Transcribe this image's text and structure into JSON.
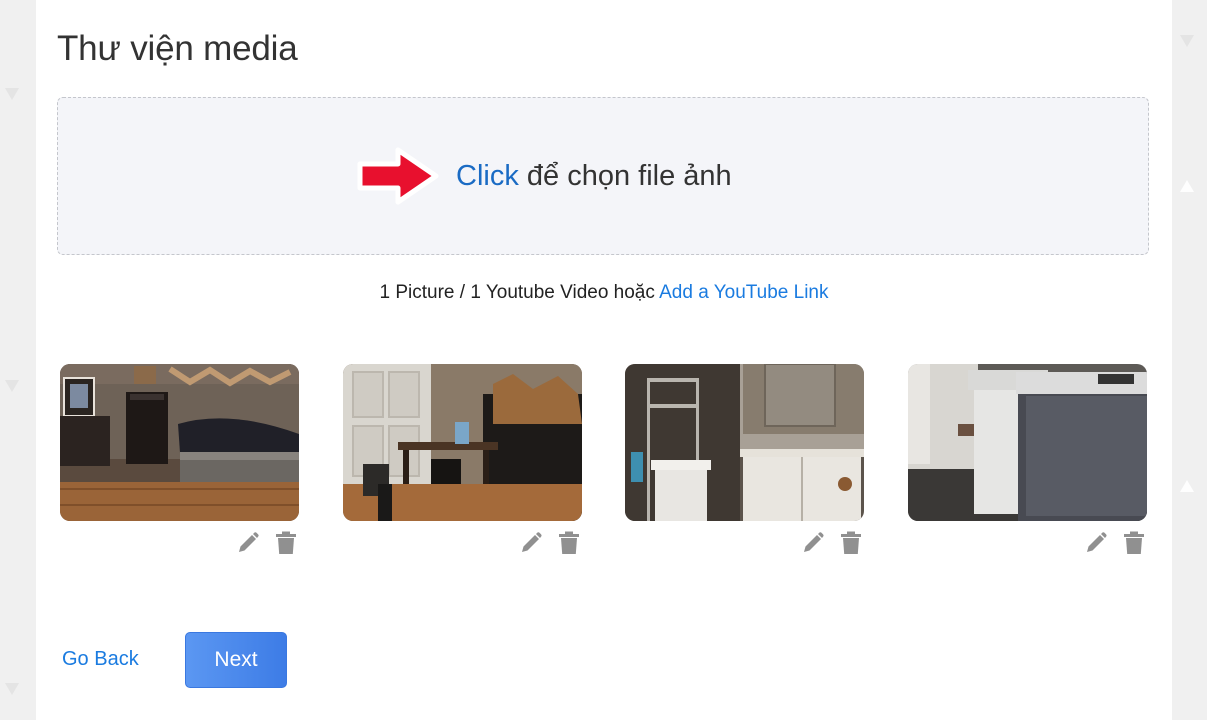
{
  "page": {
    "title": "Thư viện media"
  },
  "dropzone": {
    "click_label": "Click",
    "rest_label": " để chọn file ảnh",
    "arrow_icon": "red-arrow-right-icon",
    "click_color": "#1a6bc4",
    "arrow_color": "#e8102e"
  },
  "info": {
    "text": "1 Picture / 1 Youtube Video hoặc ",
    "link_label": "Add a YouTube Link",
    "link_color": "#1a7be0"
  },
  "gallery": {
    "items": [
      {
        "alt": "bedroom photo",
        "edit_icon": "pencil-icon",
        "delete_icon": "trash-icon"
      },
      {
        "alt": "dining room photo",
        "edit_icon": "pencil-icon",
        "delete_icon": "trash-icon"
      },
      {
        "alt": "bathroom photo",
        "edit_icon": "pencil-icon",
        "delete_icon": "trash-icon"
      },
      {
        "alt": "laundry photo",
        "edit_icon": "pencil-icon",
        "delete_icon": "trash-icon"
      }
    ]
  },
  "footer": {
    "back_label": "Go Back",
    "next_label": "Next",
    "accent": "#3d7ce6"
  }
}
